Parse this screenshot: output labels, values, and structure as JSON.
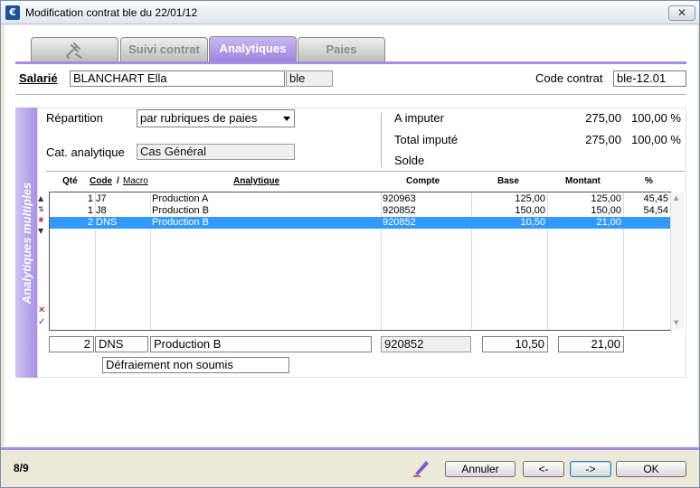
{
  "window": {
    "title": "Modification contrat ble du 22/01/12",
    "close": "✕"
  },
  "tabs": [
    {
      "label": "",
      "icon": "wrench-icon"
    },
    {
      "label": "Suivi contrat"
    },
    {
      "label": "Analytiques",
      "active": true
    },
    {
      "label": "Paies"
    }
  ],
  "header": {
    "salarie_label": "Salarié",
    "salarie_value": "BLANCHART Ella",
    "salarie_code": "ble",
    "code_contrat_label": "Code contrat",
    "code_contrat_value": "ble-12.01"
  },
  "sidebar_label": "Analytiques multiples",
  "repartition": {
    "label": "Répartition",
    "value": "par rubriques de paies"
  },
  "cat_analytique": {
    "label": "Cat. analytique",
    "value": "Cas Général"
  },
  "summary": {
    "a_imputer": {
      "label": "A imputer",
      "amount": "275,00",
      "percent": "100,00 %"
    },
    "total_impute": {
      "label": "Total imputé",
      "amount": "275,00",
      "percent": "100,00 %"
    },
    "solde": {
      "label": "Solde"
    }
  },
  "table": {
    "headers": {
      "qte": "Qté",
      "code": "Code",
      "slash": "/",
      "macro": "Macro",
      "analytique": "Analytique",
      "compte": "Compte",
      "base": "Base",
      "montant": "Montant",
      "pct": "%"
    },
    "rows": [
      {
        "qte": "1",
        "code": "J7",
        "analytique": "Production A",
        "compte": "920963",
        "base": "125,00",
        "montant": "125,00",
        "pct": "45,45"
      },
      {
        "qte": "1",
        "code": "J8",
        "analytique": "Production B",
        "compte": "920852",
        "base": "150,00",
        "montant": "150,00",
        "pct": "54,54"
      },
      {
        "qte": "2",
        "code": "DNS",
        "analytique": "Production B",
        "compte": "920852",
        "base": "10,50",
        "montant": "21,00",
        "pct": "",
        "selected": true
      }
    ]
  },
  "edit": {
    "qte": "2",
    "code": "DNS",
    "analytique": "Production B",
    "compte": "920852",
    "base": "10,50",
    "montant": "21,00",
    "description": "Défraiement non soumis"
  },
  "footer": {
    "pager": "8/9",
    "cancel": "Annuler",
    "prev": "<-",
    "next": "->",
    "ok": "OK"
  },
  "colors": {
    "accent": "#a58fe3",
    "selection": "#3399ff"
  }
}
